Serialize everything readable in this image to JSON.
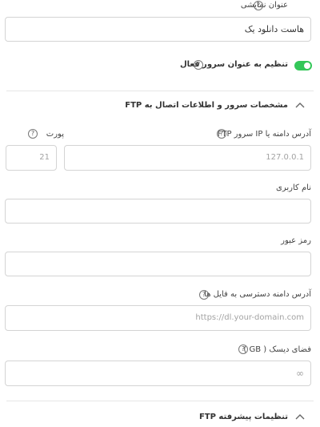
{
  "display_name": {
    "label": "عنوان نمایشی",
    "value": "هاست دانلود یک",
    "help": "?"
  },
  "active_server": {
    "label": "تنظیم به عنوان سرور فعال",
    "enabled": true,
    "help": "?"
  },
  "ftp_section": {
    "title": "مشخصات سرور و اطلاعات اتصال به FTP",
    "server_address": {
      "label": "آدرس دامنه یا IP سرور FTP",
      "placeholder": "127.0.0.1",
      "help": "?"
    },
    "port": {
      "label": "پورت",
      "placeholder": "21",
      "help": "?"
    },
    "username": {
      "label": "نام کاربری",
      "value": ""
    },
    "password": {
      "label": "رمز عبور",
      "value": ""
    },
    "file_access_domain": {
      "label": "آدرس دامنه دسترسی به فایل ها",
      "placeholder": "https://dl.your-domain.com",
      "help": "?"
    },
    "disk_space": {
      "label": "فضای دیسک ( GB )",
      "placeholder": "∞",
      "help": "?"
    }
  },
  "advanced_section": {
    "title": "تنظیمات پیشرفته FTP"
  },
  "colors": {
    "toggle_on": "#34c759",
    "border": "#d4d4d4"
  }
}
